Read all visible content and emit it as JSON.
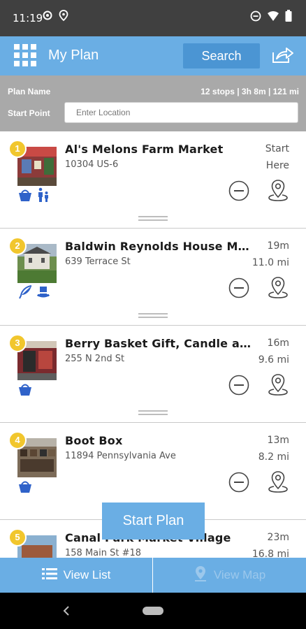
{
  "status_bar": {
    "time": "11:19",
    "left_icons": [
      "settings-icon",
      "location-pin-icon"
    ],
    "right_icons": [
      "dnd-icon",
      "wifi-icon",
      "battery-icon"
    ]
  },
  "header": {
    "title": "My Plan",
    "search_label": "Search",
    "menu_icon": "grid-menu-icon",
    "share_icon": "share-icon"
  },
  "plan": {
    "name_label": "Plan Name",
    "stats": "12 stops | 3h 8m | 121 mi",
    "start_point_label": "Start Point",
    "start_point_placeholder": "Enter Location",
    "start_point_value": ""
  },
  "stops": [
    {
      "number": "1",
      "name": "Al's Melons Farm Market",
      "address": "10304 US-6",
      "time": "Start",
      "distance": "Here",
      "categories": [
        "shopping-basket-icon",
        "family-icon"
      ]
    },
    {
      "number": "2",
      "name": "Baldwin Reynolds House Mus...",
      "address": "639 Terrace St",
      "time": "19m",
      "distance": "11.0 mi",
      "categories": [
        "quill-pen-icon",
        "top-hat-icon"
      ]
    },
    {
      "number": "3",
      "name": "Berry Basket Gift, Candle and ...",
      "address": "255 N 2nd St",
      "time": "16m",
      "distance": "9.6 mi",
      "categories": [
        "shopping-basket-icon"
      ]
    },
    {
      "number": "4",
      "name": "Boot Box",
      "address": "11894 Pennsylvania Ave",
      "time": "13m",
      "distance": "8.2 mi",
      "categories": [
        "shopping-basket-icon"
      ]
    },
    {
      "number": "5",
      "name": "Canal Park Market Village",
      "address": "158 Main St #18",
      "time": "23m",
      "distance": "16.8 mi",
      "categories": []
    }
  ],
  "start_plan_label": "Start Plan",
  "tabs": {
    "list_label": "View List",
    "map_label": "View Map"
  },
  "colors": {
    "header_blue": "#6aaee4",
    "search_blue": "#4b95d3",
    "badge_yellow": "#f1c62d",
    "category_blue": "#2f62c9",
    "plan_bar_gray": "#a9a9a9"
  }
}
